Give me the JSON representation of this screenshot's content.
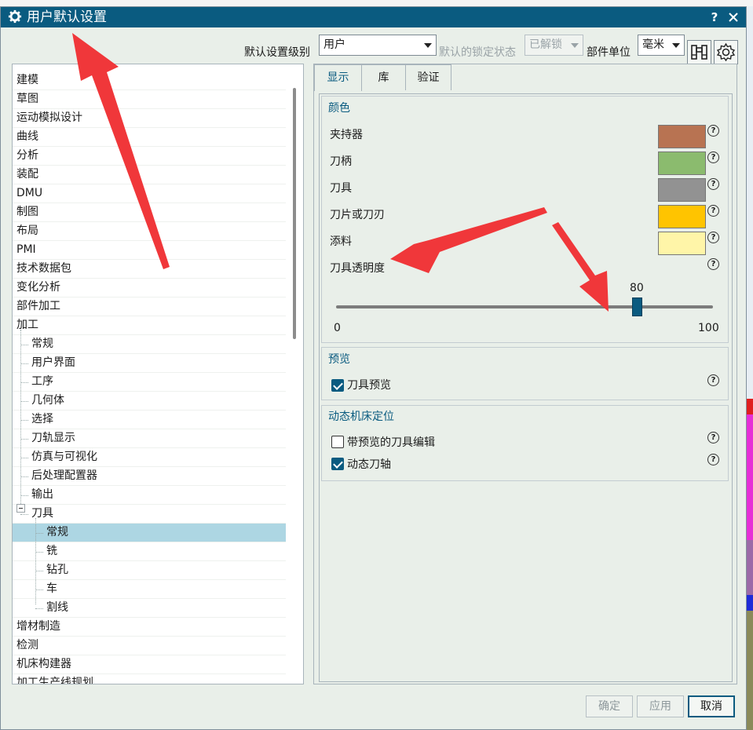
{
  "window": {
    "title": "用户默认设置",
    "help_label": "?",
    "close_label": "✕"
  },
  "toolbar": {
    "level_label": "默认设置级别",
    "level_value": "用户",
    "lock_label": "默认的锁定状态",
    "lock_value": "已解锁",
    "unit_label": "部件单位",
    "unit_value": "毫米"
  },
  "tree": {
    "items": [
      {
        "label": "建模"
      },
      {
        "label": "草图"
      },
      {
        "label": "运动模拟设计"
      },
      {
        "label": "曲线"
      },
      {
        "label": "分析"
      },
      {
        "label": "装配"
      },
      {
        "label": "DMU"
      },
      {
        "label": "制图"
      },
      {
        "label": "布局"
      },
      {
        "label": "PMI"
      },
      {
        "label": "技术数据包"
      },
      {
        "label": "变化分析"
      },
      {
        "label": "部件加工"
      },
      {
        "label": "加工"
      },
      {
        "label": "常规"
      },
      {
        "label": "用户界面"
      },
      {
        "label": "工序"
      },
      {
        "label": "几何体"
      },
      {
        "label": "选择"
      },
      {
        "label": "刀轨显示"
      },
      {
        "label": "仿真与可视化"
      },
      {
        "label": "后处理配置器"
      },
      {
        "label": "输出"
      },
      {
        "label": "刀具"
      },
      {
        "label": "常规"
      },
      {
        "label": "铣"
      },
      {
        "label": "钻孔"
      },
      {
        "label": "车"
      },
      {
        "label": "割线"
      },
      {
        "label": "增材制造"
      },
      {
        "label": "检测"
      },
      {
        "label": "机床构建器"
      },
      {
        "label": "加工生产线规划"
      }
    ]
  },
  "tabs": [
    {
      "label": "显示"
    },
    {
      "label": "库"
    },
    {
      "label": "验证"
    }
  ],
  "color_group": {
    "title": "颜色",
    "rows": [
      {
        "label": "夹持器",
        "color": "#b87352"
      },
      {
        "label": "刀柄",
        "color": "#8bbb6e"
      },
      {
        "label": "刀具",
        "color": "#929292"
      },
      {
        "label": "刀片或刀刃",
        "color": "#ffc400"
      },
      {
        "label": "添料",
        "color": "#fff5a8"
      }
    ],
    "transparency_label": "刀具透明度",
    "slider_value": "80",
    "slider_min": "0",
    "slider_max": "100",
    "slider_fraction": 0.8
  },
  "preview_group": {
    "title": "预览",
    "items": [
      {
        "label": "刀具预览",
        "checked": true
      }
    ]
  },
  "machine_group": {
    "title": "动态机床定位",
    "items": [
      {
        "label": "带预览的刀具编辑",
        "checked": false
      },
      {
        "label": "动态刀轴",
        "checked": true
      }
    ]
  },
  "footer": {
    "ok_label": "确定",
    "apply_label": "应用",
    "cancel_label": "取消"
  },
  "colors": {
    "title_bar": "#0a5b80",
    "selection": "#add6e3",
    "annotation": "#f0373a"
  }
}
